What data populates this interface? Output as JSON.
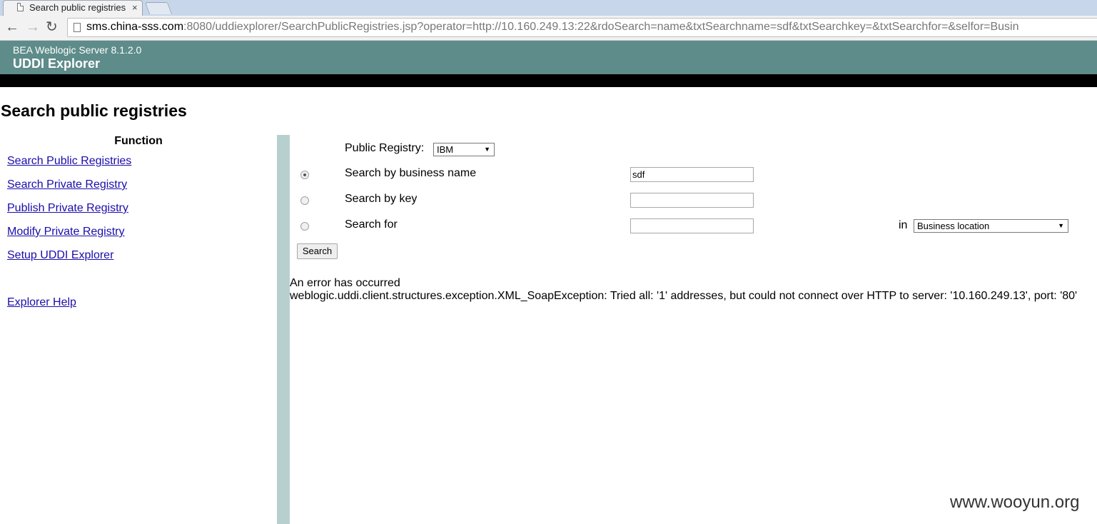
{
  "browser": {
    "tab_title": "Search public registries",
    "tab_close": "×",
    "url_host": "sms.china-sss.com",
    "url_rest": ":8080/uddiexplorer/SearchPublicRegistries.jsp?operator=http://10.160.249.13:22&rdoSearch=name&txtSearchname=sdf&txtSearchkey=&txtSearchfor=&selfor=Busin",
    "back_glyph": "←",
    "forward_glyph": "→",
    "reload_glyph": "↻"
  },
  "header": {
    "product": "BEA Weblogic Server 8.1.2.0",
    "app_name": "UDDI Explorer"
  },
  "page": {
    "title": "Search public registries"
  },
  "sidebar": {
    "heading": "Function",
    "items": [
      {
        "label": "Search Public Registries"
      },
      {
        "label": "Search Private Registry"
      },
      {
        "label": "Publish Private Registry"
      },
      {
        "label": "Modify Private Registry"
      },
      {
        "label": "Setup UDDI Explorer"
      },
      {
        "label": "Explorer Help"
      }
    ]
  },
  "form": {
    "registry_label": "Public Registry:",
    "registry_value": "IBM",
    "options": [
      {
        "label": "Search by business name",
        "value": "sdf",
        "checked": true
      },
      {
        "label": "Search by key",
        "value": "",
        "checked": false
      },
      {
        "label": "Search for",
        "value": "",
        "checked": false
      }
    ],
    "in_label": "in",
    "in_value": "Business location",
    "search_button": "Search"
  },
  "error": {
    "title": "An error has occurred",
    "message": "weblogic.uddi.client.structures.exception.XML_SoapException: Tried all: '1' addresses, but could not connect over HTTP to server: '10.160.249.13', port: '80'"
  },
  "watermark": "www.wooyun.org",
  "colors": {
    "header_bg": "#5e8c8a",
    "divider": "#b8cfcf",
    "link": "#1a0dab"
  }
}
